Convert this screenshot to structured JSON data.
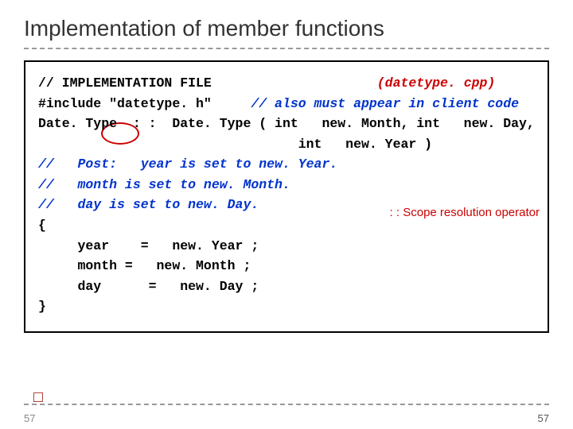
{
  "title": "Implementation of member functions",
  "code": {
    "l1a": "// IMPLEMENTATION FILE                     ",
    "l1b": "(datetype. cpp)",
    "l2a": "#include \"datetype. h\"     ",
    "l2b": "// also must appear in client code",
    "blank1": "",
    "l3": "Date. Type  : :  Date. Type ( int   new. Month, int   new. Day,",
    "l4": "                                 int   new. Year )",
    "l5": "//   Post:   year is set to new. Year.",
    "l6": "//   month is set to new. Month.",
    "l7": "//   day is set to new. Day.",
    "l8": "{",
    "l9": "     year    =   new. Year ;",
    "l10": "     month =   new. Month ;",
    "l11": "     day      =   new. Day ;",
    "l12": "}"
  },
  "annotation": ": : Scope resolution operator",
  "page_left": "57",
  "page_right": "57"
}
